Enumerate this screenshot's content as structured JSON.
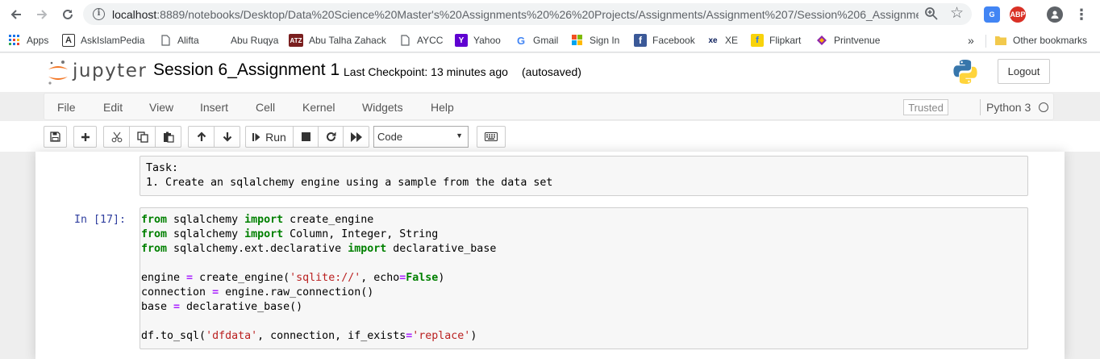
{
  "browser": {
    "url_host": "localhost",
    "url_rest": ":8889/notebooks/Desktop/Data%20Science%20Master's%20Assignments%20%26%20Projects/Assignments/Assignment%207/Session%206_Assignme...",
    "abp_label": "ABP",
    "bookmarks": [
      {
        "label": "Apps"
      },
      {
        "label": "AskIslamPedia"
      },
      {
        "label": "Alifta"
      },
      {
        "label": "Abu Ruqya"
      },
      {
        "label": "Abu Talha Zahack"
      },
      {
        "label": "AYCC"
      },
      {
        "label": "Yahoo"
      },
      {
        "label": "Gmail"
      },
      {
        "label": "Sign In"
      },
      {
        "label": "Facebook"
      },
      {
        "label": "XE"
      },
      {
        "label": "Flipkart"
      },
      {
        "label": "Printvenue"
      }
    ],
    "overflow_label": "»",
    "other_bookmarks": "Other bookmarks"
  },
  "header": {
    "brand": "jupyter",
    "notebook_title": "Session 6_Assignment 1",
    "checkpoint": "Last Checkpoint: 13 minutes ago",
    "autosave": "(autosaved)",
    "logout": "Logout"
  },
  "menu": {
    "items": [
      "File",
      "Edit",
      "View",
      "Insert",
      "Cell",
      "Kernel",
      "Widgets",
      "Help"
    ],
    "trusted": "Trusted",
    "kernel": "Python 3"
  },
  "toolbar": {
    "run_label": "Run",
    "cell_type": "Code"
  },
  "cells": {
    "markdown_text": "Task:\n1. Create an sqlalchemy engine using a sample from the data set",
    "code_prompt": "In [17]:",
    "code_lines": [
      [
        {
          "t": "from",
          "c": "kw"
        },
        {
          "t": " sqlalchemy "
        },
        {
          "t": "import",
          "c": "kw"
        },
        {
          "t": " create_engine"
        }
      ],
      [
        {
          "t": "from",
          "c": "kw"
        },
        {
          "t": " sqlalchemy "
        },
        {
          "t": "import",
          "c": "kw"
        },
        {
          "t": " Column, Integer, String"
        }
      ],
      [
        {
          "t": "from",
          "c": "kw"
        },
        {
          "t": " sqlalchemy.ext.declarative "
        },
        {
          "t": "import",
          "c": "kw"
        },
        {
          "t": " declarative_base"
        }
      ],
      [],
      [
        {
          "t": "engine "
        },
        {
          "t": "=",
          "c": "op"
        },
        {
          "t": " create_engine("
        },
        {
          "t": "'sqlite://'",
          "c": "str"
        },
        {
          "t": ", echo"
        },
        {
          "t": "=",
          "c": "op"
        },
        {
          "t": "False",
          "c": "kw"
        },
        {
          "t": ")"
        }
      ],
      [
        {
          "t": "connection "
        },
        {
          "t": "=",
          "c": "op"
        },
        {
          "t": " engine.raw_connection()"
        }
      ],
      [
        {
          "t": "base "
        },
        {
          "t": "=",
          "c": "op"
        },
        {
          "t": " declarative_base()"
        }
      ],
      [],
      [
        {
          "t": "df.to_sql("
        },
        {
          "t": "'dfdata'",
          "c": "str"
        },
        {
          "t": ", connection, if_exists"
        },
        {
          "t": "=",
          "c": "op"
        },
        {
          "t": "'replace'",
          "c": "str"
        },
        {
          "t": ")"
        }
      ]
    ]
  }
}
